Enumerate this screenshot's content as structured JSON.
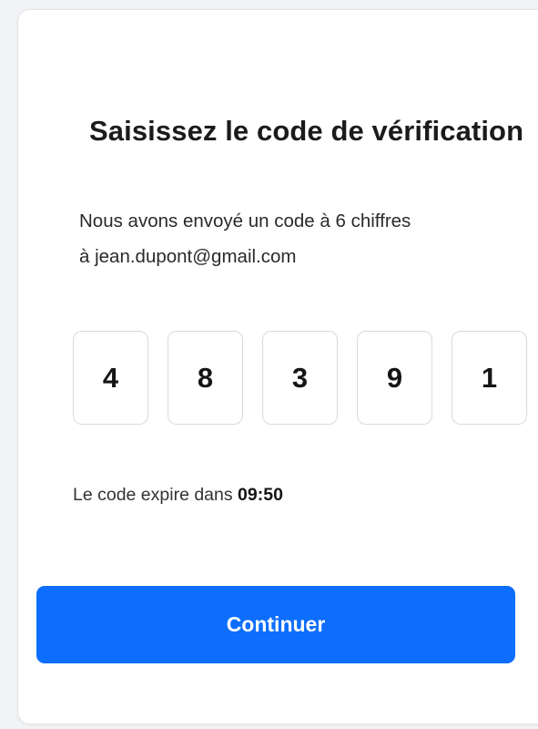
{
  "card": {
    "title": "Saisissez le code de vérification",
    "description_line1": "Nous avons envoyé un code à 6 chiffres",
    "description_line2": "à jean.dupont@gmail.com"
  },
  "code": {
    "digits": [
      "4",
      "8",
      "3",
      "9",
      "1"
    ]
  },
  "expiry": {
    "label": "Le code expire dans",
    "timer": "09:50"
  },
  "actions": {
    "continue_label": "Continuer"
  },
  "colors": {
    "accent": "#0d6efd",
    "card_background": "#ffffff",
    "page_background": "#f2f3f5",
    "box_border": "#d8dade"
  }
}
